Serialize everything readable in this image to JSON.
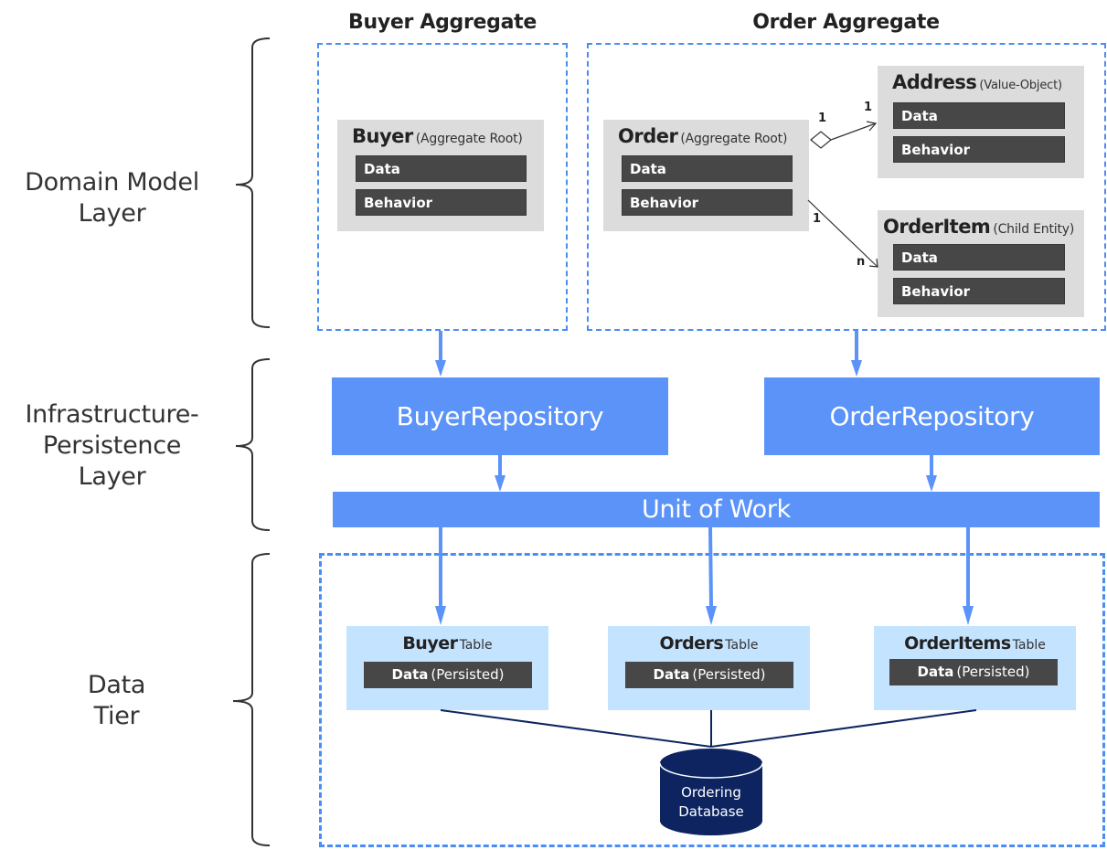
{
  "layers": {
    "domain": "Domain Model\nLayer",
    "domain_lines": [
      "Domain Model",
      "Layer"
    ],
    "infra_lines": [
      "Infrastructure-",
      "Persistence",
      "Layer"
    ],
    "data_lines": [
      "Data",
      "Tier"
    ]
  },
  "aggregates": {
    "buyer": {
      "title": "Buyer Aggregate",
      "root": {
        "name": "Buyer",
        "role": "(Aggregate Root)",
        "fields": [
          "Data",
          "Behavior"
        ]
      }
    },
    "order": {
      "title": "Order Aggregate",
      "root": {
        "name": "Order",
        "role": "(Aggregate Root)",
        "fields": [
          "Data",
          "Behavior"
        ]
      },
      "address": {
        "name": "Address",
        "role": "(Value-Object)",
        "fields": [
          "Data",
          "Behavior"
        ]
      },
      "order_item": {
        "name": "OrderItem",
        "role": "(Child Entity)",
        "fields": [
          "Data",
          "Behavior"
        ]
      }
    }
  },
  "relations": {
    "order_address": {
      "source_mult": "1",
      "target_mult": "1"
    },
    "order_items": {
      "source_mult": "1",
      "target_mult": "n"
    }
  },
  "infrastructure": {
    "buyer_repo": "BuyerRepository",
    "order_repo": "OrderRepository",
    "unit_of_work": "Unit of Work"
  },
  "data_tier": {
    "tables": [
      {
        "name": "Buyer",
        "suffix": "Table",
        "data_bold": "Data",
        "data_note": "(Persisted)"
      },
      {
        "name": "Orders",
        "suffix": "Table",
        "data_bold": "Data",
        "data_note": "(Persisted)"
      },
      {
        "name": "OrderItems",
        "suffix": "Table",
        "data_bold": "Data",
        "data_note": "(Persisted)"
      }
    ],
    "database": {
      "line1": "Ordering",
      "line2": "Database"
    }
  },
  "colors": {
    "accent_blue": "#5b93f8",
    "dashed_border": "#4a8df5",
    "entity_gray": "#dcdcdc",
    "bar_dark": "#474747",
    "table_light_blue": "#c4e3fe",
    "database_navy": "#0d2460"
  }
}
